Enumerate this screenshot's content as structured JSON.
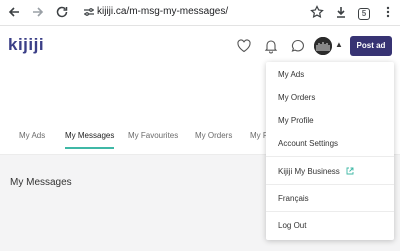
{
  "browser": {
    "url": "kijiji.ca/m-msg-my-messages/",
    "extension_badge": "5"
  },
  "header": {
    "logo": "kijiji",
    "post_ad_label": "Post ad"
  },
  "tabs": [
    {
      "label": "My Ads"
    },
    {
      "label": "My Messages"
    },
    {
      "label": "My Favourites"
    },
    {
      "label": "My Orders"
    },
    {
      "label": "My P"
    }
  ],
  "messages": {
    "title": "My Messages"
  },
  "dropdown": {
    "items": [
      {
        "label": "My Ads"
      },
      {
        "label": "My Orders"
      },
      {
        "label": "My Profile"
      },
      {
        "label": "Account Settings"
      },
      {
        "label": "Kijiji My Business"
      },
      {
        "label": "Français"
      },
      {
        "label": "Log Out"
      }
    ]
  },
  "colors": {
    "brand": "#373373",
    "logo": "#3b3f87",
    "active_tab_underline": "#3fb8a6"
  }
}
